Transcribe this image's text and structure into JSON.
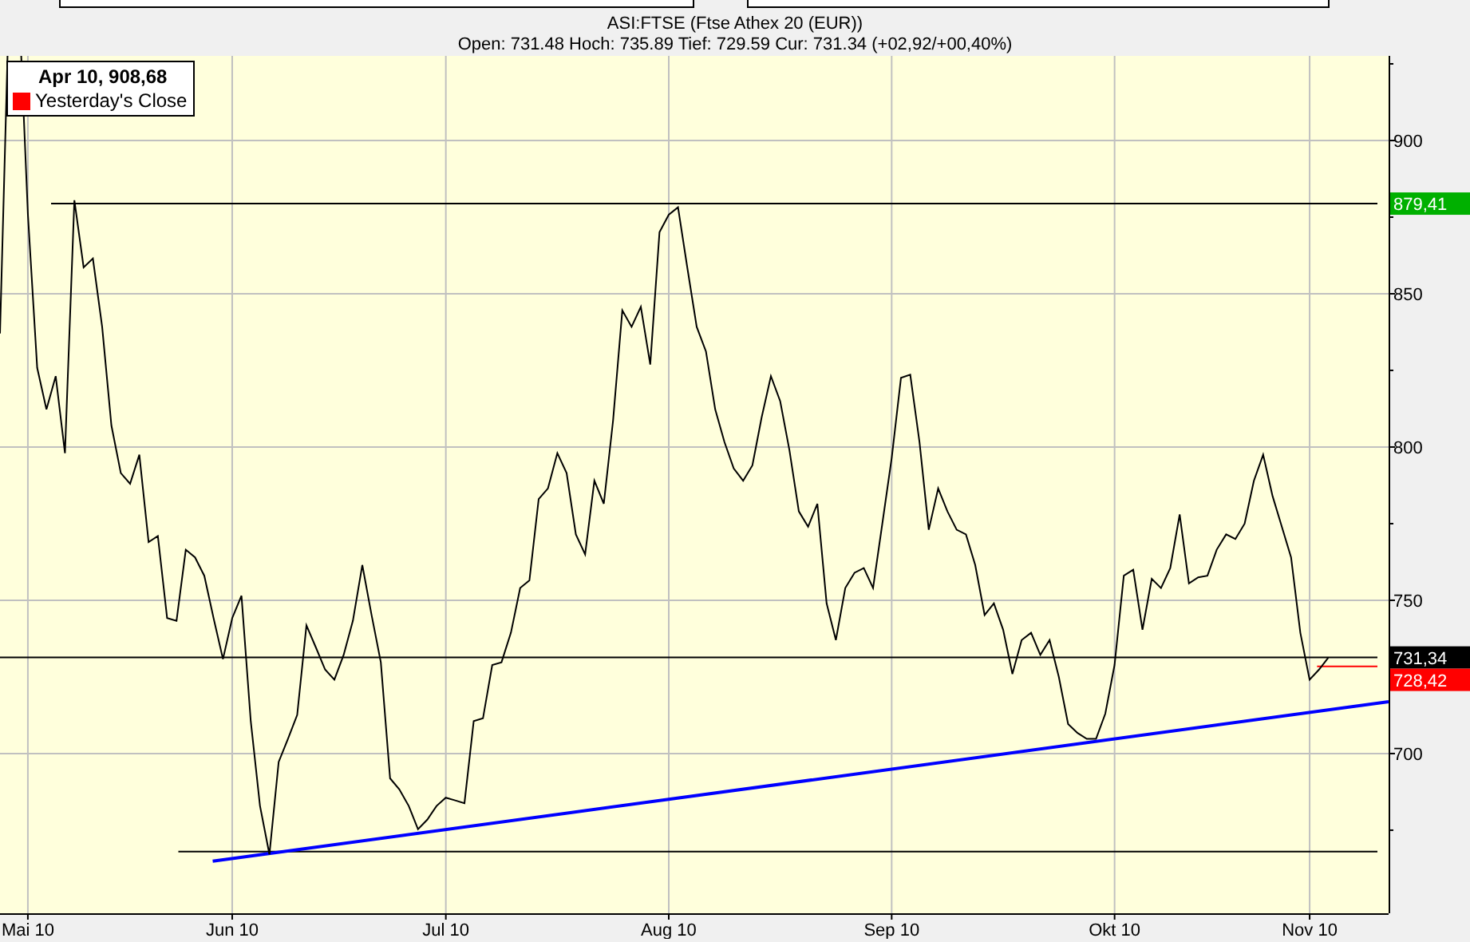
{
  "top_panels": [
    {
      "kind": "panel"
    },
    {
      "kind": "panel"
    }
  ],
  "chart": {
    "chart_data": {
      "type": "line",
      "grid": true,
      "title": "ASI:FTSE (Ftse Athex 20 (EUR))",
      "ylim": [
        647.9,
        927.6
      ],
      "categories": [
        null,
        null,
        null,
        "Mai 10",
        null,
        null,
        null,
        null,
        null,
        null,
        null,
        null,
        null,
        null,
        null,
        null,
        null,
        null,
        null,
        null,
        null,
        null,
        null,
        null,
        null,
        "Jun 10",
        null,
        null,
        null,
        null,
        null,
        null,
        null,
        null,
        null,
        null,
        null,
        null,
        null,
        null,
        null,
        null,
        null,
        null,
        null,
        null,
        null,
        null,
        "Jul 10",
        null,
        null,
        null,
        null,
        null,
        null,
        null,
        null,
        null,
        null,
        null,
        null,
        null,
        null,
        null,
        null,
        null,
        null,
        null,
        null,
        null,
        null,
        null,
        "Aug 10",
        null,
        null,
        null,
        null,
        null,
        null,
        null,
        null,
        null,
        null,
        null,
        null,
        null,
        null,
        null,
        null,
        null,
        null,
        null,
        null,
        null,
        null,
        null,
        "Sep 10",
        null,
        null,
        null,
        null,
        null,
        null,
        null,
        null,
        null,
        null,
        null,
        null,
        null,
        null,
        null,
        null,
        null,
        null,
        null,
        null,
        null,
        null,
        null,
        "Okt 10",
        null,
        null,
        null,
        null,
        null,
        null,
        null,
        null,
        null,
        null,
        null,
        null,
        null,
        null,
        null,
        null,
        null,
        null,
        null,
        null,
        "Nov 10",
        null,
        null
      ],
      "yticks": [
        700,
        750,
        800,
        850,
        900
      ],
      "series": [
        {
          "color": "#000000",
          "values": [
            837,
            null,
            null,
            875.8,
            825.8,
            812.3,
            823.1,
            798,
            880.5,
            858.6,
            861.5,
            839.2,
            807,
            791.5,
            788,
            797.5,
            769,
            771,
            744.2,
            743.3,
            766.5,
            764,
            758,
            744.2,
            730.8,
            744.2,
            751.5,
            710.6,
            682.9,
            667.1,
            697.3,
            704.8,
            712.6,
            741.8,
            734.6,
            727.4,
            724.1,
            732.2,
            743.3,
            761.5,
            745.2,
            729.8,
            691.9,
            688.3,
            682.9,
            675.3,
            678.4,
            682.9,
            685.6,
            684.7,
            683.8,
            710.6,
            711.5,
            728.9,
            729.8,
            739.4,
            754,
            756.5,
            783,
            786.5,
            798,
            791.5,
            771.5,
            765,
            789,
            781.5,
            808.6,
            844.6,
            839.2,
            845.7,
            826.9,
            870.1,
            875.8,
            878.2,
            858.6,
            839.2,
            831.2,
            812.3,
            801.6,
            793,
            789,
            794,
            809.7,
            823.1,
            815,
            799,
            779,
            774,
            781.5,
            749,
            737,
            754,
            759,
            760.5,
            754,
            775,
            796.5,
            822.6,
            823.6,
            801.6,
            773,
            786.5,
            779,
            773,
            771.5,
            761.5,
            745.2,
            749,
            740.4,
            726,
            737,
            739.4,
            732.2,
            737,
            725,
            709.6,
            706.7,
            704.8,
            704.8,
            713,
            728.9,
            758,
            760,
            740.4,
            757,
            754,
            760.5,
            778,
            755.5,
            757.5,
            758,
            766.5,
            771.5,
            770,
            775,
            789,
            797.5,
            784,
            774,
            764,
            739.4,
            724.1,
            727.4,
            731.3
          ]
        }
      ]
    },
    "overlays": [
      {
        "kind": "resistance",
        "tag": "879,41"
      },
      {
        "kind": "support"
      },
      {
        "kind": "current",
        "tag": "731,34"
      },
      {
        "kind": "previous_close",
        "tag": "728,42"
      },
      {
        "kind": "trend"
      }
    ]
  },
  "quote_line": "Open: 731.48 Hoch: 735.89 Tief: 729.59 Cur: 731.34 (+02,92/+00,40%)",
  "legend": {
    "title": "Apr 10, 908,68",
    "items": [
      {
        "label": "Yesterday's Close",
        "color": "#ff0000"
      }
    ]
  }
}
